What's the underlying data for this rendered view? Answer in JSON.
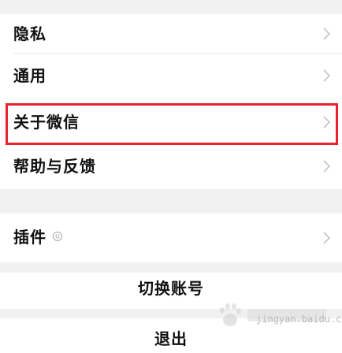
{
  "settings": {
    "items": [
      {
        "label": "隐私"
      },
      {
        "label": "通用"
      },
      {
        "label": "关于微信"
      },
      {
        "label": "帮助与反馈"
      },
      {
        "label": "插件"
      }
    ],
    "switch_account_label": "切换账号",
    "logout_label": "退出"
  },
  "watermark": {
    "text": "jingyan.baidu.com"
  },
  "colors": {
    "highlight": "#e8232f",
    "page_background": "#f1f1f1",
    "row_background": "#ffffff"
  },
  "icons": {
    "chevron": "chevron-right-icon",
    "plugin_badge": "plugin-badge-icon",
    "watermark_logo": "baidu-paw-icon"
  }
}
